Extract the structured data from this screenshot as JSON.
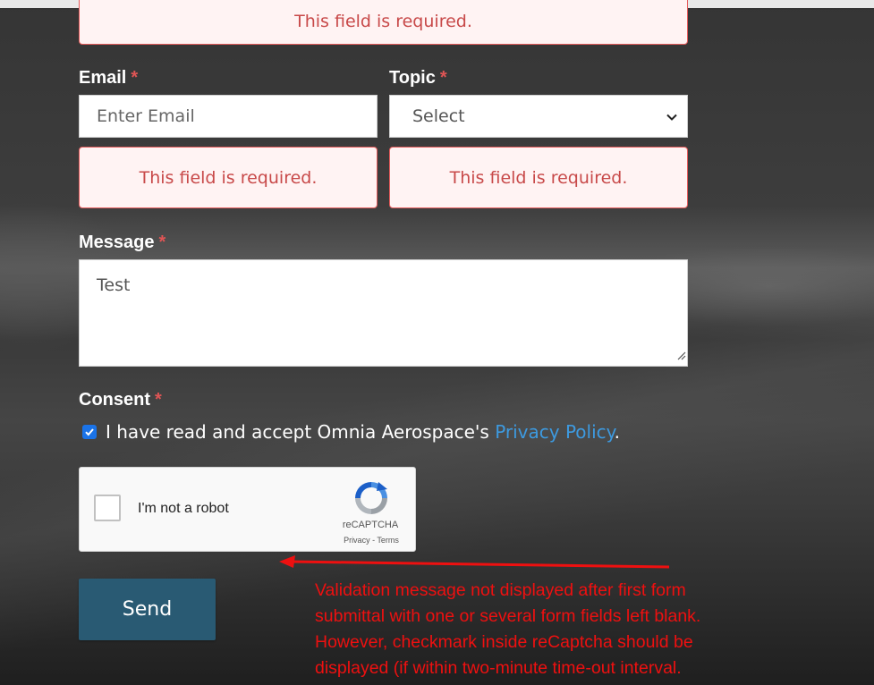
{
  "form": {
    "top_error": "This field is required.",
    "email": {
      "label": "Email",
      "required_mark": "*",
      "placeholder": "Enter Email",
      "error": "This field is required."
    },
    "topic": {
      "label": "Topic",
      "required_mark": "*",
      "selected": "Select",
      "error": "This field is required."
    },
    "message": {
      "label": "Message",
      "required_mark": "*",
      "value": "Test"
    },
    "consent": {
      "label": "Consent",
      "required_mark": "*",
      "checked": true,
      "text_before": "I have read and accept Omnia Aerospace's ",
      "link_text": "Privacy Policy",
      "text_after": "."
    },
    "recaptcha": {
      "label": "I'm not a robot",
      "brand": "reCAPTCHA",
      "privacy": "Privacy",
      "separator": " - ",
      "terms": "Terms"
    },
    "send_label": "Send"
  },
  "annotation": {
    "lines": [
      "Validation message not displayed after first form",
      "submittal with one or several form fields left blank.",
      "However, checkmark inside reCaptcha should be",
      "displayed (if within two-minute time-out interval."
    ],
    "color": "#ee1010"
  },
  "colors": {
    "error_text": "#c84949",
    "error_border": "#e55b5b",
    "error_bg": "#fff3f3",
    "button_bg": "#295a73",
    "link": "#3d9ae0",
    "checkbox": "#1a73e8"
  }
}
